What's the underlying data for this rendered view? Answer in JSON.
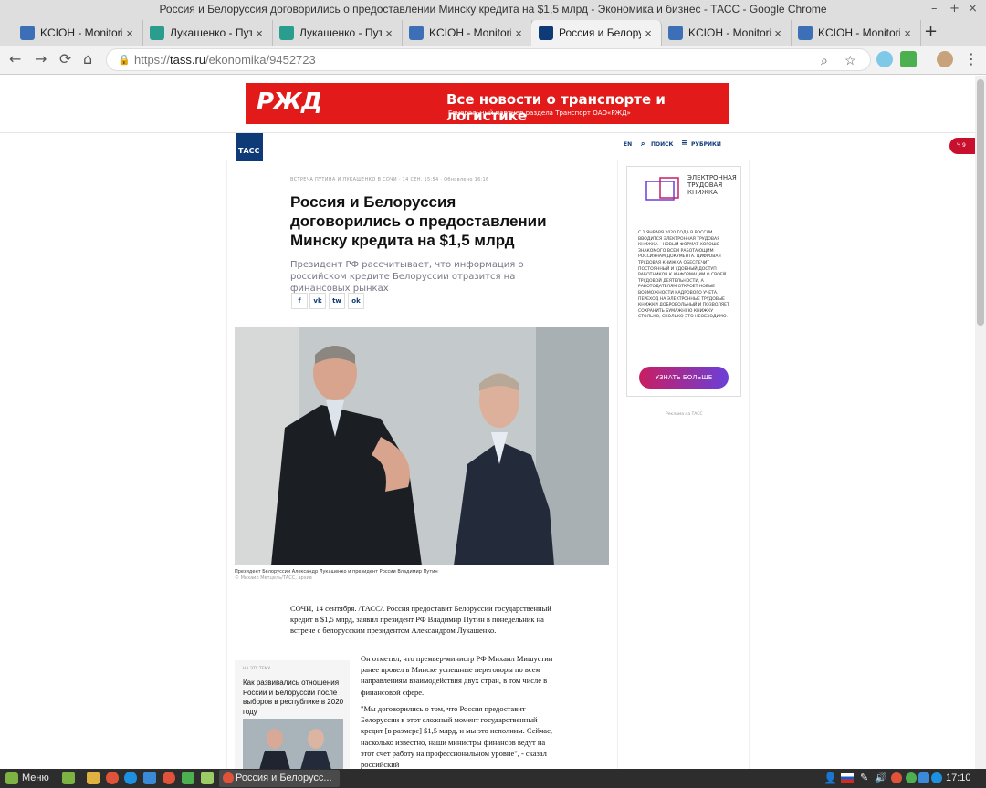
{
  "window": {
    "title": "Россия и Белоруссия договорились о предоставлении Минску кредита на $1,5 млрд - Экономика и бизнес - ТАСС - Google Chrome"
  },
  "tabs": [
    {
      "label": "KCIOH - Monitoring",
      "icon": "ksion-icon",
      "color": "#3d6fb6"
    },
    {
      "label": "Лукашенко - Путин",
      "icon": "globe-icon",
      "color": "#2a9d8f"
    },
    {
      "label": "Лукашенко - Путин",
      "icon": "globe-icon",
      "color": "#2a9d8f"
    },
    {
      "label": "KCIOH - Monitoring",
      "icon": "ksion-icon",
      "color": "#3d6fb6"
    },
    {
      "label": "Россия и Белоруссия",
      "icon": "tass-icon",
      "color": "#0e3a77"
    },
    {
      "label": "KCIOH - Monitoring",
      "icon": "ksion-icon",
      "color": "#3d6fb6"
    },
    {
      "label": "KCIOH - Monitoring",
      "icon": "ksion-icon",
      "color": "#3d6fb6"
    }
  ],
  "address": {
    "scheme": "https://",
    "host": "tass.ru",
    "path": "/ekonomika/9452723"
  },
  "banner": {
    "logo": "РЖД",
    "title": "Все новости о транспорте и логистике",
    "sub": "Генеральный партнер раздела Транспорт ОАО«РЖД»"
  },
  "header": {
    "logo": "ТАСС",
    "lang": "EN",
    "search": "ПОИСК",
    "rubrics": "РУБРИКИ",
    "live": "Ч 9"
  },
  "article": {
    "kicker": "ВСТРЕЧА ПУТИНА И ЛУКАШЕНКО В СОЧИ · 14 СЕН, 15:54 · Обновлено 16:16",
    "title": "Россия и Белоруссия договорились о предоставлении Минску кредита на $1,5 млрд",
    "lead": "Президент РФ рассчитывает, что информация о российском кредите Белоруссии отразится на финансовых рынках",
    "share": [
      "f",
      "vk",
      "tw",
      "ok"
    ],
    "caption": "Президент Белоруссии Александр Лукашенко и президент России Владимир Путин",
    "credit": "© Михаил Метцель/ТАСС, архив",
    "p1": "СОЧИ, 14 сентября. /ТАСС/. Россия предоставит Белоруссии государственный кредит в $1,5 млрд, заявил президент РФ Владимир Путин в понедельник на встрече с белорусским президентом Александром Лукашенко.",
    "p2": "Он отметил, что премьер-министр РФ Михаил Мишустин ранее провел в Минске успешные переговоры по всем направлениям взаимодействия двух стран, в том числе в финансовой сфере.",
    "p3": "\"Мы договорились о том, что Россия предоставит Белоруссии в этот сложный момент государственный кредит [в размере] $1,5 млрд, и мы это исполним. Сейчас, насколько известно, наши министры финансов ведут на этот счет работу на профессиональном уровне\", - сказал российский"
  },
  "related": {
    "label": "НА ЭТУ ТЕМУ",
    "title": "Как развивались отношения России и Белоруссии после выборов в республике в 2020 году"
  },
  "ad": {
    "title": "ЭЛЕКТРОННАЯ ТРУДОВАЯ КНИЖКА",
    "body": "С 1 ЯНВАРЯ 2020 ГОДА В РОССИИ ВВОДИТСЯ ЭЛЕКТРОННАЯ ТРУДОВАЯ КНИЖКА – НОВЫЙ ФОРМАТ ХОРОШО ЗНАКОМОГО ВСЕМ РАБОТАЮЩИМ РОССИЯНАМ ДОКУМЕНТА. ЦИФРОВАЯ ТРУДОВАЯ КНИЖКА ОБЕСПЕЧИТ ПОСТОЯННЫЙ И УДОБНЫЙ ДОСТУП РАБОТНИКОВ К ИНФОРМАЦИИ О СВОЕЙ ТРУДОВОЙ ДЕЯТЕЛЬНОСТИ, А РАБОТОДАТЕЛЯМ ОТКРОЕТ НОВЫЕ ВОЗМОЖНОСТИ КАДРОВОГО УЧЕТА. ПЕРЕХОД НА ЭЛЕКТРОННЫЕ ТРУДОВЫЕ КНИЖКИ ДОБРОВОЛЬНЫЙ И ПОЗВОЛЯЕТ СОХРАНИТЬ БУМАЖНУЮ КНИЖКУ СТОЛЬКО, СКОЛЬКО ЭТО НЕОБХОДИМО.",
    "button": "УЗНАТЬ БОЛЬШЕ",
    "label": "Реклама на ТАСС"
  },
  "taskbar": {
    "menu": "Меню",
    "window": "Россия и Белорусс...",
    "clock": "17:10"
  }
}
